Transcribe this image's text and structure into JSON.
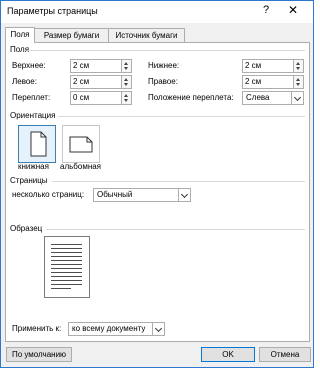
{
  "dialog": {
    "title": "Параметры страницы",
    "help_glyph": "?",
    "close_glyph": "✕"
  },
  "tabs": [
    {
      "label": "Поля",
      "active": true
    },
    {
      "label": "Размер бумаги",
      "active": false
    },
    {
      "label": "Источник бумаги",
      "active": false
    }
  ],
  "margins": {
    "section_title": "Поля",
    "top_label": "Верхнее:",
    "top_value": "2 см",
    "bottom_label": "Нижнее:",
    "bottom_value": "2 см",
    "left_label": "Левое:",
    "left_value": "2 см",
    "right_label": "Правое:",
    "right_value": "2 см",
    "gutter_label": "Переплет:",
    "gutter_value": "0 см",
    "gutter_pos_label": "Положение переплета:",
    "gutter_pos_value": "Слева"
  },
  "orientation": {
    "section_title": "Ориентация",
    "portrait_label": "книжная",
    "landscape_label": "альбомная",
    "selected": "portrait"
  },
  "pages": {
    "section_title": "Страницы",
    "multiple_label": "несколько страниц:",
    "multiple_value": "Обычный"
  },
  "preview": {
    "section_title": "Образец",
    "apply_label": "Применить к:",
    "apply_value": "ко всему документу"
  },
  "footer": {
    "default_button": "По умолчанию",
    "ok_button": "OK",
    "cancel_button": "Отмена"
  },
  "colors": {
    "accent": "#0078d7",
    "selected_bg": "#e5f1fb"
  }
}
